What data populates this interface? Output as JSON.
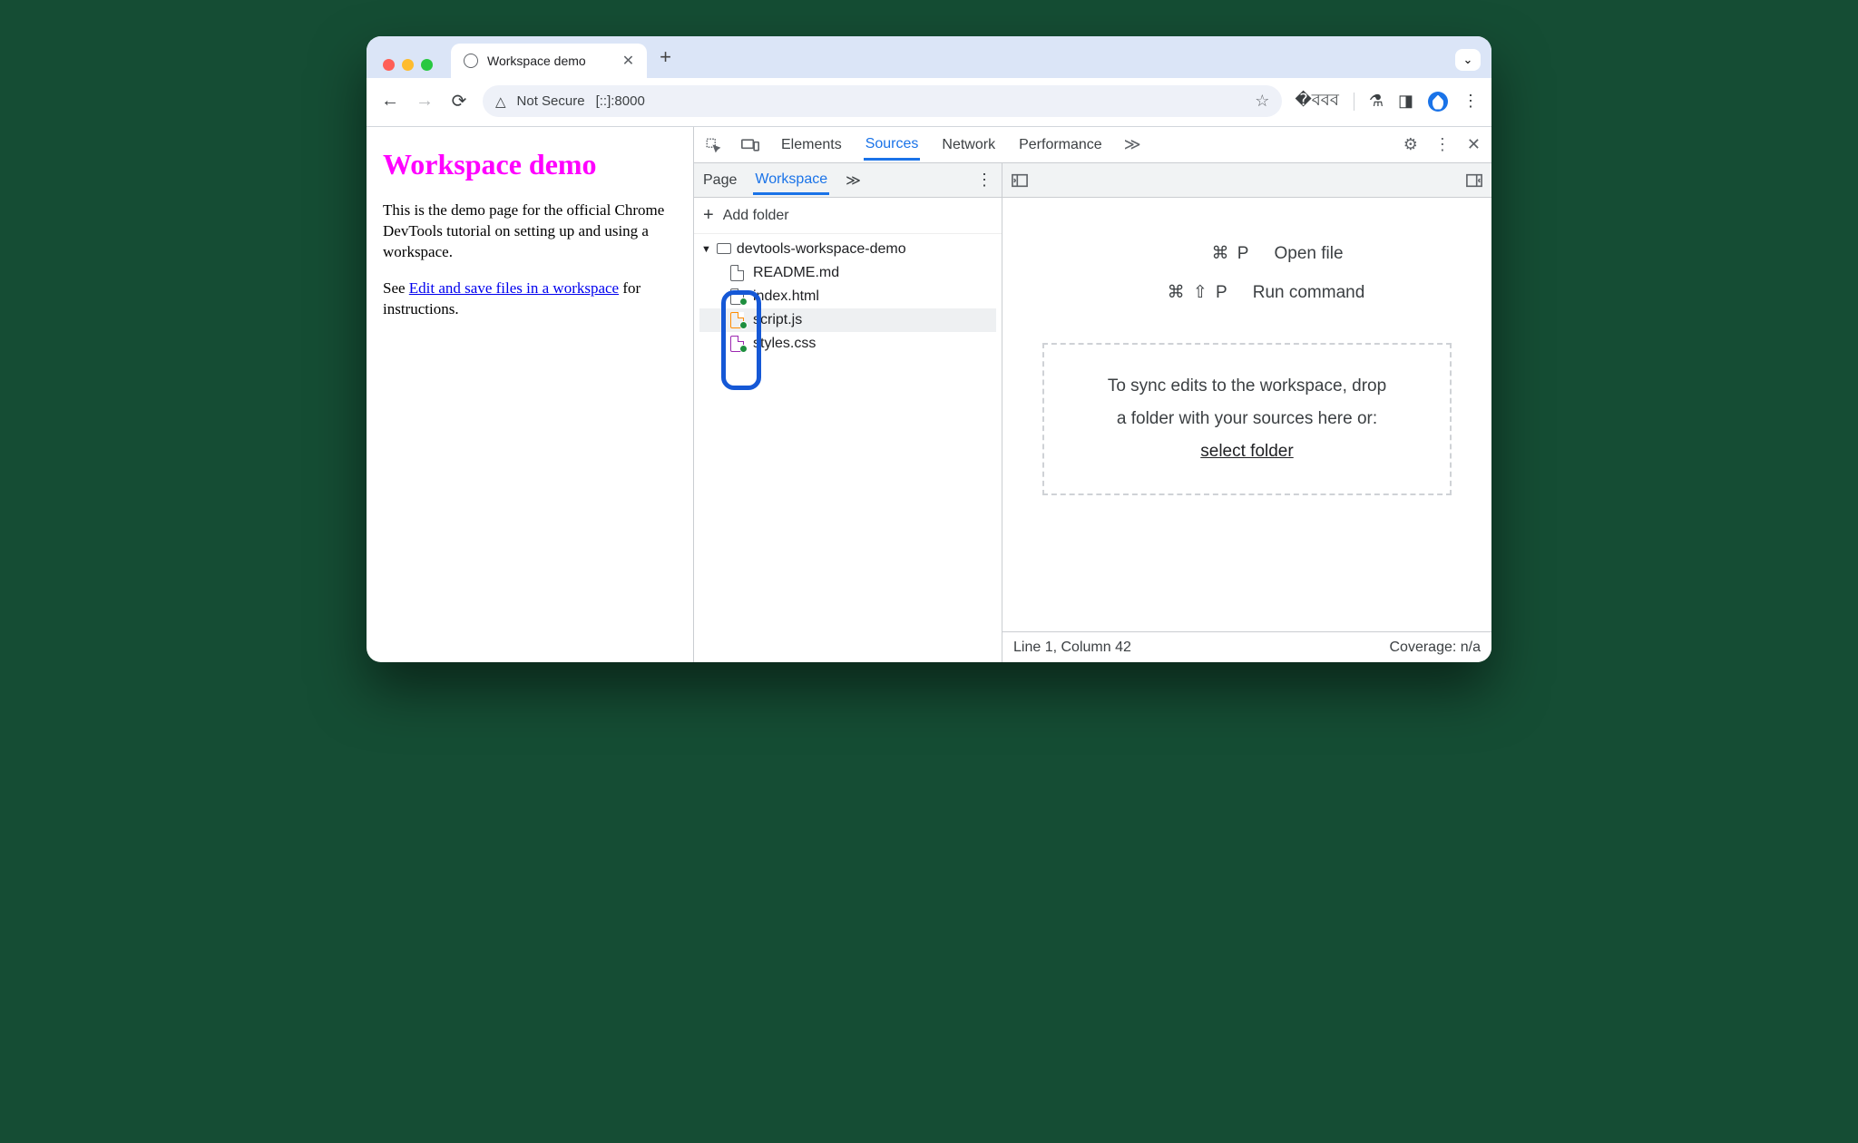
{
  "browser": {
    "tab_title": "Workspace demo",
    "not_secure": "Not Secure",
    "url": "[::]:8000"
  },
  "page": {
    "heading": "Workspace demo",
    "para1": "This is the demo page for the official Chrome DevTools tutorial on setting up and using a workspace.",
    "see": "See ",
    "link": "Edit and save files in a workspace",
    "closing": " for instructions."
  },
  "devtools": {
    "tabs": {
      "elements": "Elements",
      "sources": "Sources",
      "network": "Network",
      "performance": "Performance"
    },
    "nav": {
      "page": "Page",
      "workspace": "Workspace"
    },
    "add_folder": "Add folder",
    "tree": {
      "folder": "devtools-workspace-demo",
      "files": [
        {
          "name": "README.md",
          "color": "gray",
          "mapped": false
        },
        {
          "name": "index.html",
          "color": "gray",
          "mapped": true
        },
        {
          "name": "script.js",
          "color": "orange",
          "mapped": true,
          "selected": true
        },
        {
          "name": "styles.css",
          "color": "purple",
          "mapped": true
        }
      ]
    },
    "shortcuts": {
      "open_keys": "⌘ P",
      "open_label": "Open file",
      "run_keys": "⌘ ⇧ P",
      "run_label": "Run command"
    },
    "drop": {
      "line1": "To sync edits to the workspace, drop",
      "line2": "a folder with your sources here or:",
      "link": "select folder"
    },
    "status": {
      "left": "Line 1, Column 42",
      "right": "Coverage: n/a"
    }
  }
}
